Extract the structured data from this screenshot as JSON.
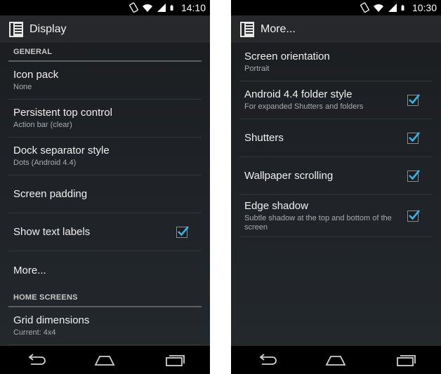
{
  "left": {
    "status": {
      "time": "14:10"
    },
    "action_bar": {
      "title": "Display"
    },
    "sections": [
      {
        "header": "GENERAL",
        "items": [
          {
            "title": "Icon pack",
            "summary": "None"
          },
          {
            "title": "Persistent top control",
            "summary": "Action bar (clear)"
          },
          {
            "title": "Dock separator style",
            "summary": "Dots (Android 4.4)"
          },
          {
            "title": "Screen padding"
          },
          {
            "title": "Show text labels",
            "checked": true
          },
          {
            "title": "More..."
          }
        ]
      },
      {
        "header": "HOME SCREENS",
        "items": [
          {
            "title": "Grid dimensions",
            "summary": "Current: 4x4"
          }
        ]
      }
    ]
  },
  "right": {
    "status": {
      "time": "10:30"
    },
    "action_bar": {
      "title": "More..."
    },
    "items": [
      {
        "title": "Screen orientation",
        "summary": "Portrait"
      },
      {
        "title": "Android 4.4 folder style",
        "summary": "For expanded Shutters and folders",
        "checked": true
      },
      {
        "title": "Shutters",
        "checked": true
      },
      {
        "title": "Wallpaper scrolling",
        "checked": true
      },
      {
        "title": "Edge shadow",
        "summary": "Subtle shadow at the top and bottom of the screen",
        "checked": true
      }
    ]
  },
  "colors": {
    "accent": "#33b5e5",
    "background": "#1f2226"
  },
  "icons": [
    "orientation-icon",
    "wifi-icon",
    "battery-icon",
    "launcher-app-icon",
    "back-icon",
    "home-icon",
    "recents-icon",
    "checkmark-icon"
  ]
}
